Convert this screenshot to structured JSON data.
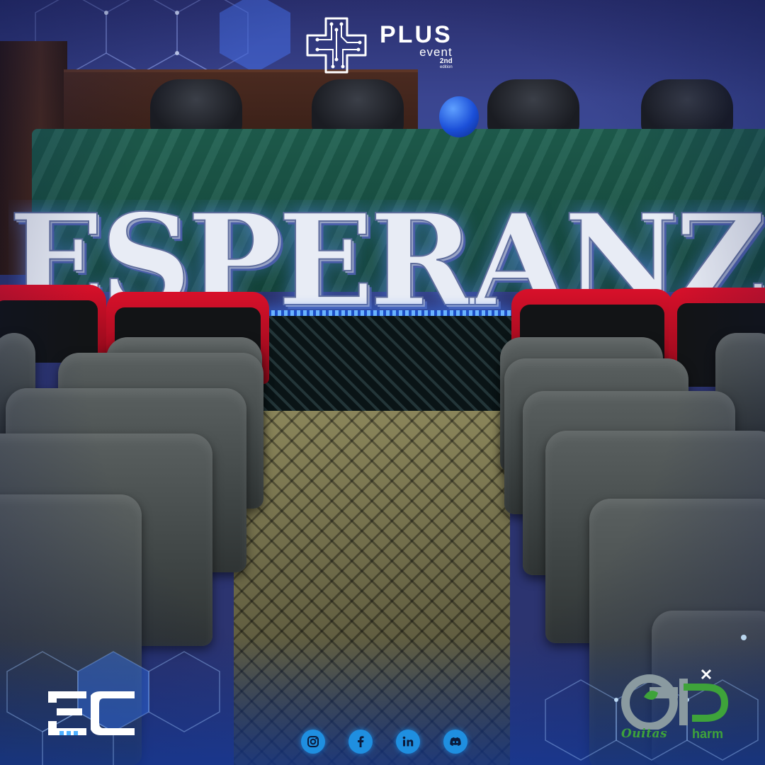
{
  "header_logo": {
    "title": "PLUS",
    "subtitle": "event",
    "edition_number": "2nd",
    "edition_word": "edition",
    "icon": "circuit-cross-icon"
  },
  "sign": {
    "text": "ESPERANZA"
  },
  "sponsor_left": {
    "icon": "ac-logo-icon"
  },
  "social": [
    {
      "icon": "instagram-icon"
    },
    {
      "icon": "facebook-icon"
    },
    {
      "icon": "linkedin-icon"
    },
    {
      "icon": "discord-icon"
    }
  ],
  "sponsor_right": {
    "name_part1": "Ouitas",
    "name_part2": "harm",
    "icon": "ouitas-pharm-logo-icon"
  },
  "colors": {
    "accent_blue": "#1f8fe0",
    "sign_glow": "#3d7dff",
    "brand_green": "#3ea33a"
  }
}
